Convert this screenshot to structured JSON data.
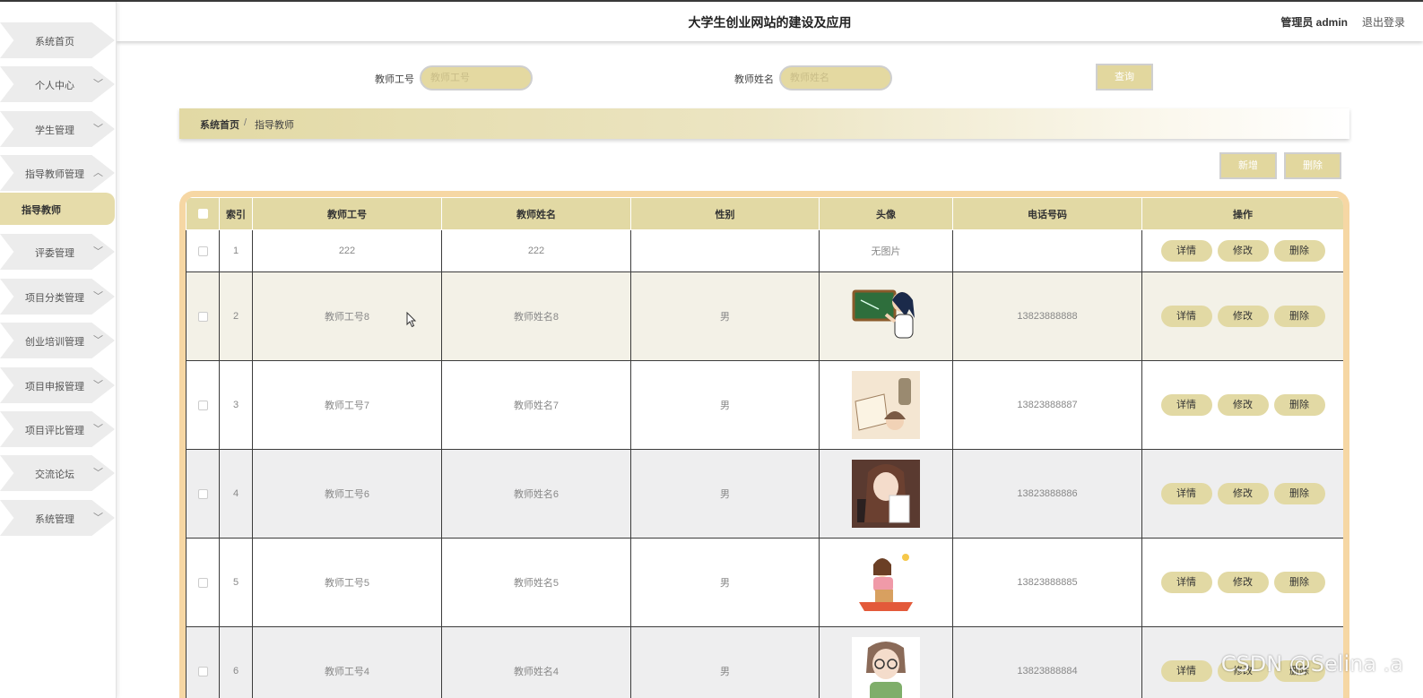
{
  "header": {
    "title": "大学生创业网站的建设及应用",
    "user": "管理员 admin",
    "logout": "退出登录"
  },
  "sidebar": {
    "items": [
      {
        "label": "系统首页"
      },
      {
        "label": "个人中心"
      },
      {
        "label": "学生管理"
      },
      {
        "label": "指导教师管理"
      },
      {
        "label": "评委管理"
      },
      {
        "label": "项目分类管理"
      },
      {
        "label": "创业培训管理"
      },
      {
        "label": "项目申报管理"
      },
      {
        "label": "项目评比管理"
      },
      {
        "label": "交流论坛"
      },
      {
        "label": "系统管理"
      }
    ],
    "active_sub": "指导教师"
  },
  "search": {
    "teacher_id_label": "教师工号",
    "teacher_id_placeholder": "教师工号",
    "teacher_name_label": "教师姓名",
    "teacher_name_placeholder": "教师姓名",
    "query_button": "查询"
  },
  "breadcrumb": {
    "home": "系统首页",
    "separator": "/",
    "current": "指导教师"
  },
  "actions": {
    "add": "新增",
    "delete": "删除"
  },
  "table": {
    "columns": [
      "索引",
      "教师工号",
      "教师姓名",
      "性别",
      "头像",
      "电话号码",
      "操作"
    ],
    "op_labels": {
      "detail": "详情",
      "edit": "修改",
      "delete": "删除"
    },
    "rows": [
      {
        "index": "1",
        "teacher_id": "222",
        "teacher_name": "222",
        "gender": "",
        "avatar": "无图片",
        "phone": ""
      },
      {
        "index": "2",
        "teacher_id": "教师工号8",
        "teacher_name": "教师姓名8",
        "gender": "男",
        "avatar": "teacher-blackboard-image",
        "phone": "13823888888"
      },
      {
        "index": "3",
        "teacher_id": "教师工号7",
        "teacher_name": "教师姓名7",
        "gender": "男",
        "avatar": "reading-book-image",
        "phone": "13823888887"
      },
      {
        "index": "4",
        "teacher_id": "教师工号6",
        "teacher_name": "教师姓名6",
        "gender": "男",
        "avatar": "girl-with-paper-image",
        "phone": "13823888886"
      },
      {
        "index": "5",
        "teacher_id": "教师工号5",
        "teacher_name": "教师姓名5",
        "gender": "男",
        "avatar": "teacher-at-desk-image",
        "phone": "13823888885"
      },
      {
        "index": "6",
        "teacher_id": "教师工号4",
        "teacher_name": "教师姓名4",
        "gender": "男",
        "avatar": "woman-glasses-image",
        "phone": "13823888884"
      }
    ]
  },
  "watermark": "CSDN @Selina .a",
  "colors": {
    "accent": "#e2d9a4",
    "table_border": "#f6d7a4",
    "sidebar_item": "#ececec"
  }
}
